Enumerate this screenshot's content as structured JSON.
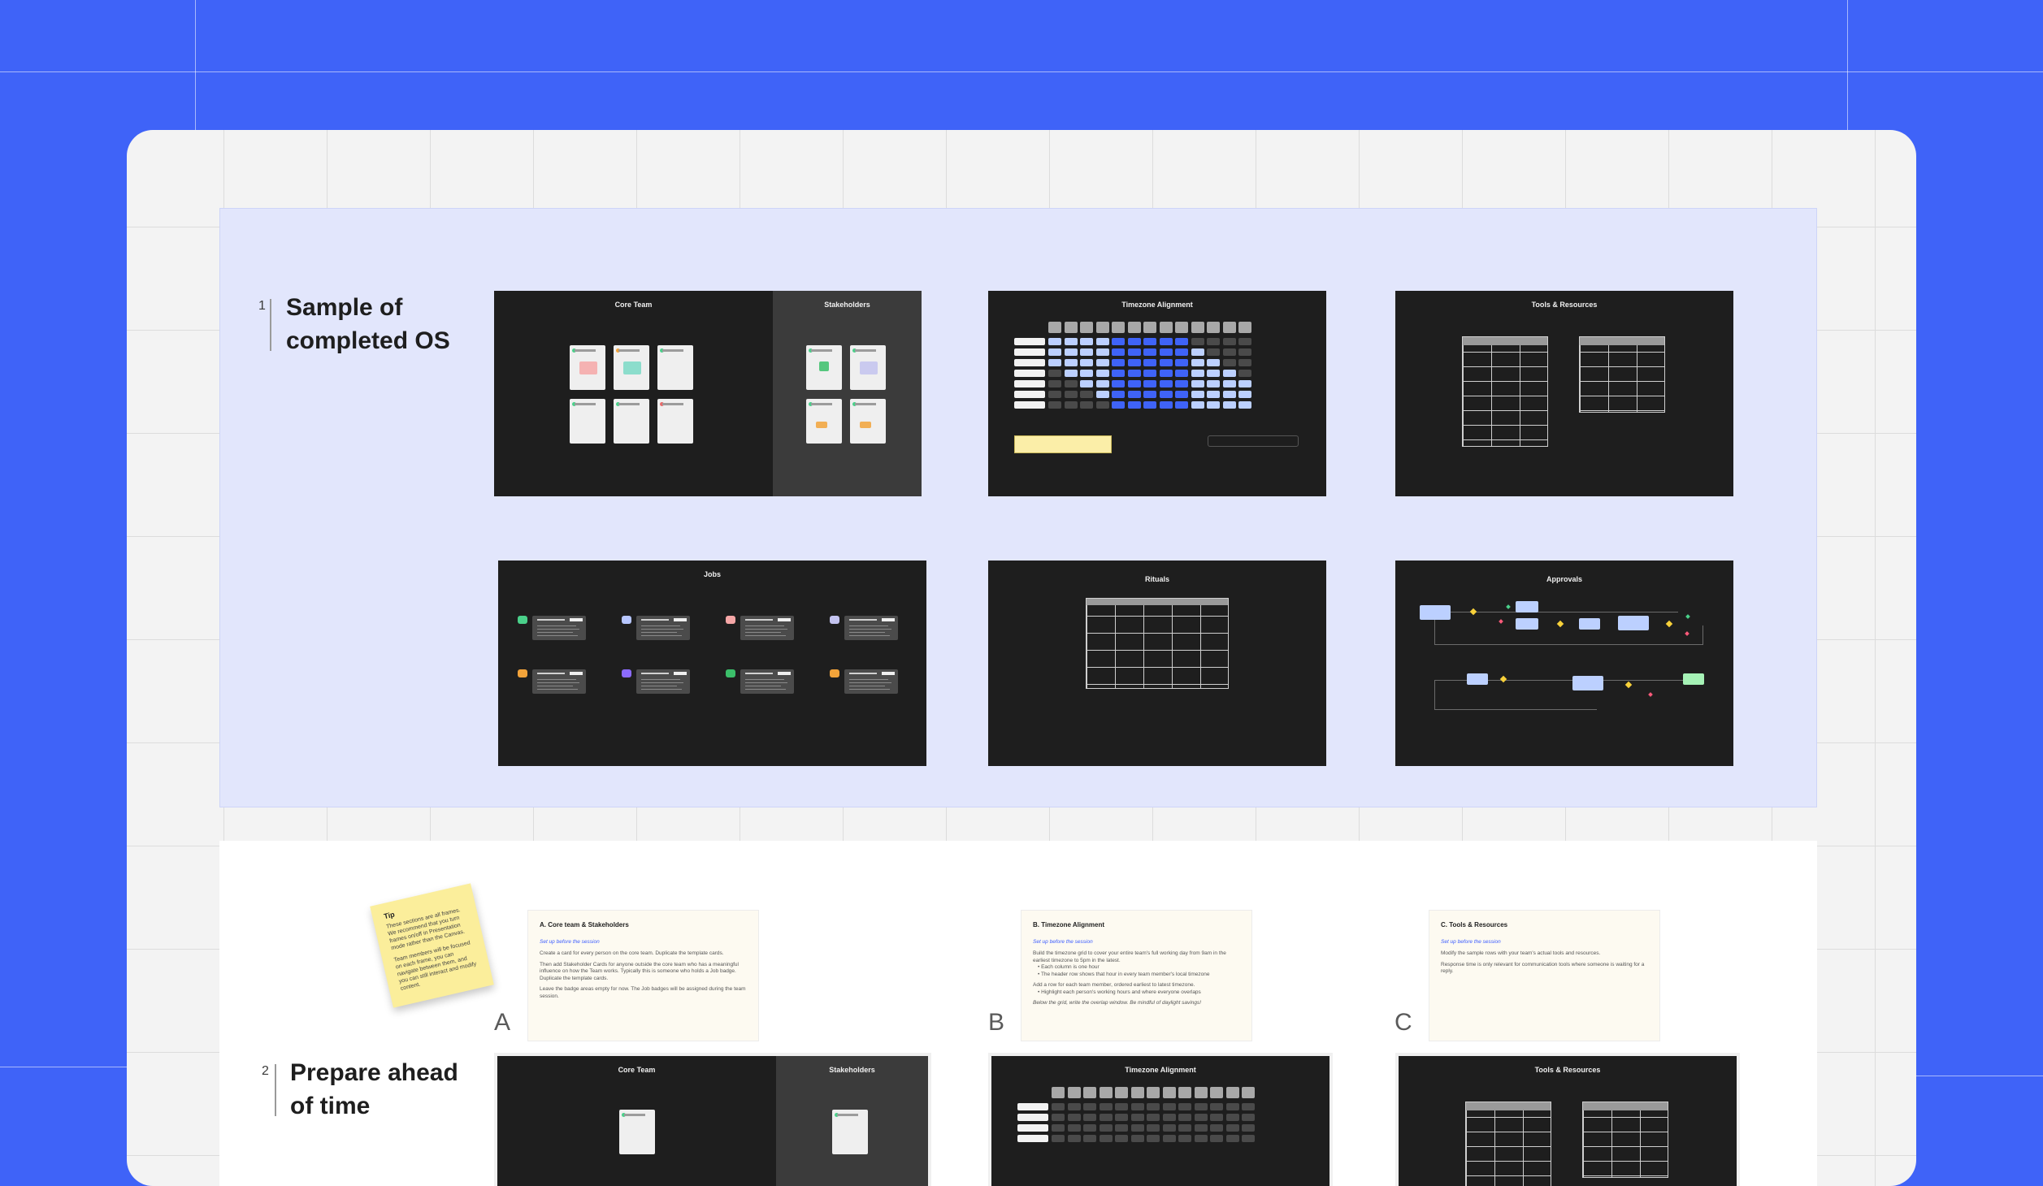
{
  "colors": {
    "canvas_bg": "#3f63f8",
    "board": "#f3f3f3",
    "section_highlight": "#e2e6fc",
    "frame": "#1e1e1e",
    "accent_blue": "#3f63f8",
    "sticky": "#fbee9b"
  },
  "section1": {
    "number": "1",
    "title": "Sample of\ncompleted OS",
    "frames": {
      "core_team": "Core Team",
      "stakeholders": "Stakeholders",
      "timezone": "Timezone Alignment",
      "tools": "Tools & Resources",
      "jobs": "Jobs",
      "rituals": "Rituals",
      "approvals": "Approvals"
    }
  },
  "section2": {
    "number": "2",
    "title": "Prepare ahead\nof time",
    "tip": {
      "heading": "Tip",
      "p1": "These sections are all frames. We recommend that you turn frames on/off in Presentation mode rather than the Canvas.",
      "p2": "Team members will be focused on each frame, you can navigate between them, and you can still interact and modify content."
    },
    "columns": [
      {
        "letter": "A",
        "title": "A. Core team & Stakeholders",
        "link": "Set up before the session",
        "body": [
          "Create a card for every person on the core team. Duplicate the template cards.",
          "Then add Stakeholder Cards for anyone outside the core team who has a meaningful influence on how the Team works. Typically this is someone who holds a Job badge. Duplicate the template cards.",
          "Leave the badge areas empty for now. The Job badges will be assigned during the team session."
        ],
        "frames": [
          "Core Team",
          "Stakeholders"
        ]
      },
      {
        "letter": "B",
        "title": "B. Timezone Alignment",
        "link": "Set up before the session",
        "body": [
          "Build the timezone grid to cover your entire team's full working day from 9am in the earliest timezone to 5pm in the latest.",
          "• Each column is one hour",
          "• The header row shows that hour in every team member's local timezone",
          "Add a row for each team member, ordered earliest to latest timezone.",
          "• Highlight each person's working hours and where everyone overlaps",
          "Below the grid, write the overlap window. Be mindful of daylight savings!"
        ],
        "frames": [
          "Timezone Alignment"
        ]
      },
      {
        "letter": "C",
        "title": "C. Tools & Resources",
        "link": "Set up before the session",
        "body": [
          "Modify the sample rows with your team's actual tools and resources.",
          "Response time is only relevant for communication tools where someone is waiting for a reply."
        ],
        "frames": [
          "Tools & Resources"
        ]
      }
    ]
  }
}
